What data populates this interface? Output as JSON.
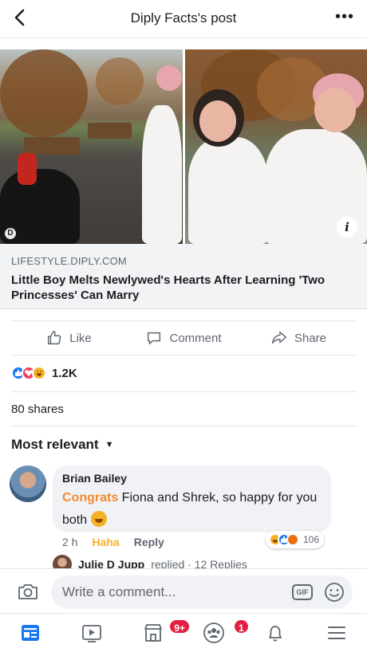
{
  "header": {
    "title": "Diply Facts's post"
  },
  "link": {
    "domain": "LIFESTYLE.DIPLY.COM",
    "title": "Little Boy Melts Newlywed's Hearts After Learning 'Two Princesses' Can Marry"
  },
  "actions": {
    "like": "Like",
    "comment": "Comment",
    "share": "Share"
  },
  "reactions": {
    "count": "1.2K",
    "types": [
      "like",
      "love",
      "haha"
    ]
  },
  "shares": "80 shares",
  "sort": {
    "label": "Most relevant"
  },
  "comment": {
    "author": "Brian Bailey",
    "tag": "Congrats",
    "text": " Fiona and Shrek, so happy for you both ",
    "time": "2 h",
    "reaction_label": "Haha",
    "reply_label": "Reply",
    "reaction_count": "106"
  },
  "replies": {
    "name": "Julie D Jupp",
    "text": "replied · 12 Replies"
  },
  "composer": {
    "placeholder": "Write a comment...",
    "gif": "GIF"
  },
  "tabbar": {
    "marketplace_badge": "9+",
    "groups_badge": "1"
  },
  "colors": {
    "brand": "#1877f2",
    "tag": "#f58a2e",
    "haha": "#f7b125",
    "badge": "#e41e3f"
  }
}
